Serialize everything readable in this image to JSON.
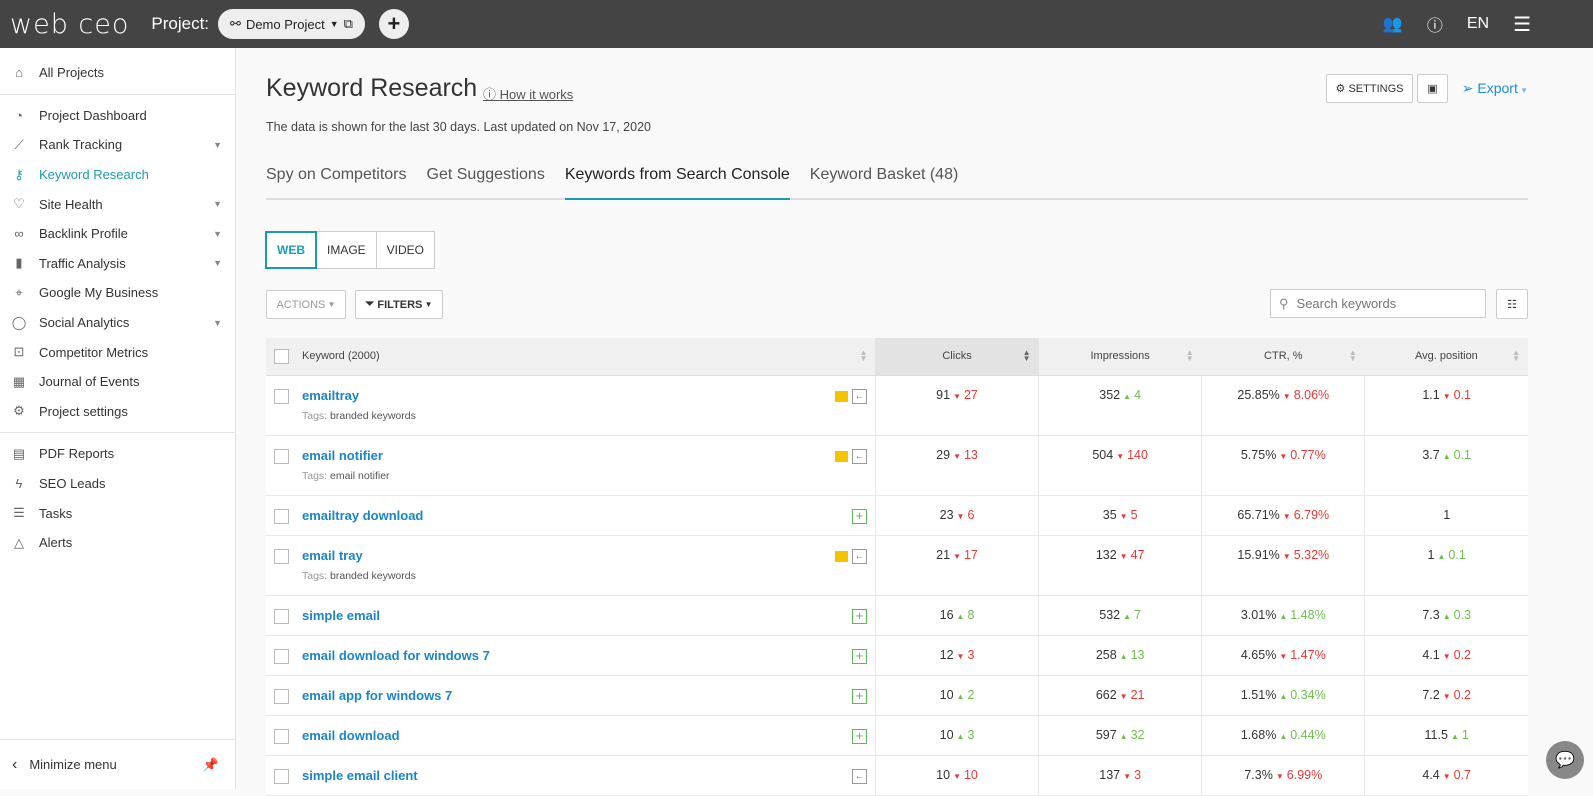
{
  "topbar": {
    "logo": "web ceo",
    "project_label": "Project:",
    "project_name": "Demo Project",
    "lang": "EN"
  },
  "sidebar": {
    "items": [
      {
        "label": "All Projects",
        "icon": "home-icon",
        "g": 0
      },
      {
        "label": "Project Dashboard",
        "icon": "gauge-icon",
        "g": 1
      },
      {
        "label": "Rank Tracking",
        "icon": "chart-line-icon",
        "g": 1,
        "caret": true
      },
      {
        "label": "Keyword Research",
        "icon": "key-icon",
        "g": 1,
        "active": true
      },
      {
        "label": "Site Health",
        "icon": "heartbeat-icon",
        "g": 1,
        "caret": true
      },
      {
        "label": "Backlink Profile",
        "icon": "link-icon",
        "g": 1,
        "caret": true
      },
      {
        "label": "Traffic Analysis",
        "icon": "bar-chart-icon",
        "g": 1,
        "caret": true
      },
      {
        "label": "Google My Business",
        "icon": "map-pin-icon",
        "g": 1
      },
      {
        "label": "Social Analytics",
        "icon": "chat-bubble-icon",
        "g": 1,
        "caret": true
      },
      {
        "label": "Competitor Metrics",
        "icon": "binoculars-icon",
        "g": 1
      },
      {
        "label": "Journal of Events",
        "icon": "calendar-icon",
        "g": 1
      },
      {
        "label": "Project settings",
        "icon": "gear-icon",
        "g": 1
      },
      {
        "label": "PDF Reports",
        "icon": "pdf-icon",
        "g": 2
      },
      {
        "label": "SEO Leads",
        "icon": "lightning-icon",
        "g": 2
      },
      {
        "label": "Tasks",
        "icon": "tasks-icon",
        "g": 2
      },
      {
        "label": "Alerts",
        "icon": "bell-icon",
        "g": 2
      }
    ],
    "minimize": "Minimize menu"
  },
  "header": {
    "title": "Keyword Research",
    "how": "How it works",
    "subtitle": "The data is shown for the last 30 days. Last updated on Nov 17, 2020",
    "settings": "SETTINGS",
    "export": "Export"
  },
  "tabs": [
    {
      "label": "Spy on Competitors"
    },
    {
      "label": "Get Suggestions"
    },
    {
      "label": "Keywords from Search Console",
      "active": true
    },
    {
      "label": "Keyword Basket (48)"
    }
  ],
  "segments": [
    {
      "label": "WEB",
      "active": true
    },
    {
      "label": "IMAGE"
    },
    {
      "label": "VIDEO"
    }
  ],
  "toolbar": {
    "actions": "ACTIONS",
    "filters": "FILTERS",
    "search_placeholder": "Search keywords"
  },
  "table": {
    "columns": [
      "Keyword (2000)",
      "Clicks",
      "Impressions",
      "CTR, %",
      "Avg. position"
    ],
    "sorted_column": "Clicks",
    "tag_label": "Tags:",
    "rows": [
      {
        "kw": "emailtray",
        "tag": "branded keywords",
        "icon": "flag",
        "c": [
          "91",
          "27",
          "dn"
        ],
        "i": [
          "352",
          "4",
          "up"
        ],
        "t": [
          "25.85%",
          "8.06%",
          "dn"
        ],
        "p": [
          "1.1",
          "0.1",
          "dn"
        ]
      },
      {
        "kw": "email notifier",
        "tag": "email notifier",
        "icon": "flag",
        "c": [
          "29",
          "13",
          "dn"
        ],
        "i": [
          "504",
          "140",
          "dn"
        ],
        "t": [
          "5.75%",
          "0.77%",
          "dn"
        ],
        "p": [
          "3.7",
          "0.1",
          "up"
        ]
      },
      {
        "kw": "emailtray download",
        "icon": "add",
        "c": [
          "23",
          "6",
          "dn"
        ],
        "i": [
          "35",
          "5",
          "dn"
        ],
        "t": [
          "65.71%",
          "6.79%",
          "dn"
        ],
        "p": [
          "1",
          "",
          ""
        ]
      },
      {
        "kw": "email tray",
        "tag": "branded keywords",
        "icon": "flag",
        "c": [
          "21",
          "17",
          "dn"
        ],
        "i": [
          "132",
          "47",
          "dn"
        ],
        "t": [
          "15.91%",
          "5.32%",
          "dn"
        ],
        "p": [
          "1",
          "0.1",
          "up"
        ]
      },
      {
        "kw": "simple email",
        "icon": "add",
        "c": [
          "16",
          "8",
          "up"
        ],
        "i": [
          "532",
          "7",
          "up"
        ],
        "t": [
          "3.01%",
          "1.48%",
          "up"
        ],
        "p": [
          "7.3",
          "0.3",
          "up"
        ]
      },
      {
        "kw": "email download for windows 7",
        "icon": "add",
        "c": [
          "12",
          "3",
          "dn"
        ],
        "i": [
          "258",
          "13",
          "up"
        ],
        "t": [
          "4.65%",
          "1.47%",
          "dn"
        ],
        "p": [
          "4.1",
          "0.2",
          "dn"
        ]
      },
      {
        "kw": "email app for windows 7",
        "icon": "add",
        "c": [
          "10",
          "2",
          "up"
        ],
        "i": [
          "662",
          "21",
          "dn"
        ],
        "t": [
          "1.51%",
          "0.34%",
          "up"
        ],
        "p": [
          "7.2",
          "0.2",
          "dn"
        ]
      },
      {
        "kw": "email download",
        "icon": "add",
        "c": [
          "10",
          "3",
          "up"
        ],
        "i": [
          "597",
          "32",
          "up"
        ],
        "t": [
          "1.68%",
          "0.44%",
          "up"
        ],
        "p": [
          "11.5",
          "1",
          "up"
        ]
      },
      {
        "kw": "simple email client",
        "icon": "arrow",
        "c": [
          "10",
          "10",
          "dn"
        ],
        "i": [
          "137",
          "3",
          "dn"
        ],
        "t": [
          "7.3%",
          "6.99%",
          "dn"
        ],
        "p": [
          "4.4",
          "0.7",
          "dn"
        ]
      }
    ]
  },
  "colors": {
    "accent": "#1a9bb5",
    "link": "#1a85c8",
    "up": "#6cbf4a",
    "down": "#e53935",
    "topbar": "#444444"
  }
}
